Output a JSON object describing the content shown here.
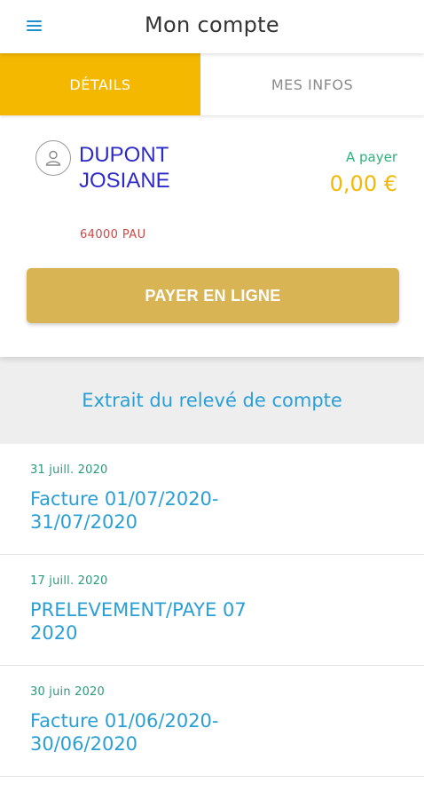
{
  "header": {
    "title": "Mon compte",
    "menu_icon": "hamburger-menu-icon"
  },
  "tabs": [
    {
      "label": "DÉTAILS",
      "active": true
    },
    {
      "label": "MES INFOS",
      "active": false
    }
  ],
  "account": {
    "name_line1": "DUPONT",
    "name_line2": "JOSIANE",
    "address": "64000  PAU",
    "due_label": "A payer",
    "due_amount": "0,00 €",
    "pay_button": "PAYER EN LIGNE"
  },
  "statement": {
    "title": "Extrait du relevé de compte",
    "entries": [
      {
        "date": "31 juill. 2020",
        "label": "Facture 01/07/2020-31/07/2020"
      },
      {
        "date": "17 juill. 2020",
        "label": "PRELEVEMENT/PAYE 07 2020"
      },
      {
        "date": "30 juin 2020",
        "label": "Facture 01/06/2020-30/06/2020"
      }
    ]
  },
  "colors": {
    "accent": "#f5b800",
    "link_blue": "#2a9fd6",
    "name_blue": "#2d2ac8",
    "pay_button": "#d9b454",
    "green": "#2db27a"
  }
}
